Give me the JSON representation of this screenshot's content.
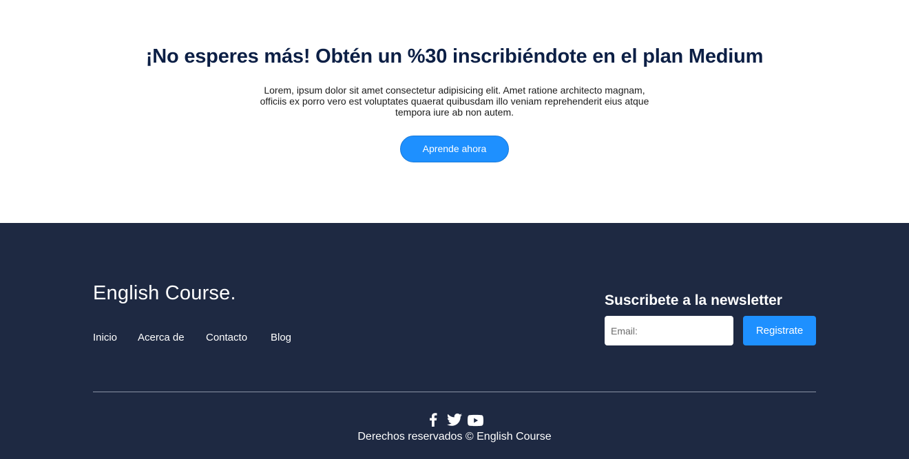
{
  "promo": {
    "title": "¡No esperes más! Obtén un %30 inscribiéndote en el plan Medium",
    "text": "Lorem, ipsum dolor sit amet consectetur adipisicing elit. Amet ratione architecto magnam, officiis ex porro vero est voluptates quaerat quibusdam illo veniam reprehenderit eius atque tempora iure ab non autem.",
    "button_label": "Aprende ahora"
  },
  "footer": {
    "brand": "English Course.",
    "nav": [
      {
        "label": "Inicio"
      },
      {
        "label": "Acerca de"
      },
      {
        "label": "Contacto"
      },
      {
        "label": "Blog"
      }
    ],
    "newsletter": {
      "title": "Suscribete a la newsletter",
      "email_placeholder": "Email:",
      "email_value": "",
      "button_label": "Registrate"
    },
    "social": [
      {
        "icon": "facebook-icon"
      },
      {
        "icon": "twitter-icon"
      },
      {
        "icon": "youtube-icon"
      }
    ],
    "copyright": "Derechos reservados © English Course"
  },
  "colors": {
    "primary": "#1e90ff",
    "heading": "#0c1f45",
    "footer_bg": "#1e2942",
    "footer_text": "#ffffff"
  }
}
